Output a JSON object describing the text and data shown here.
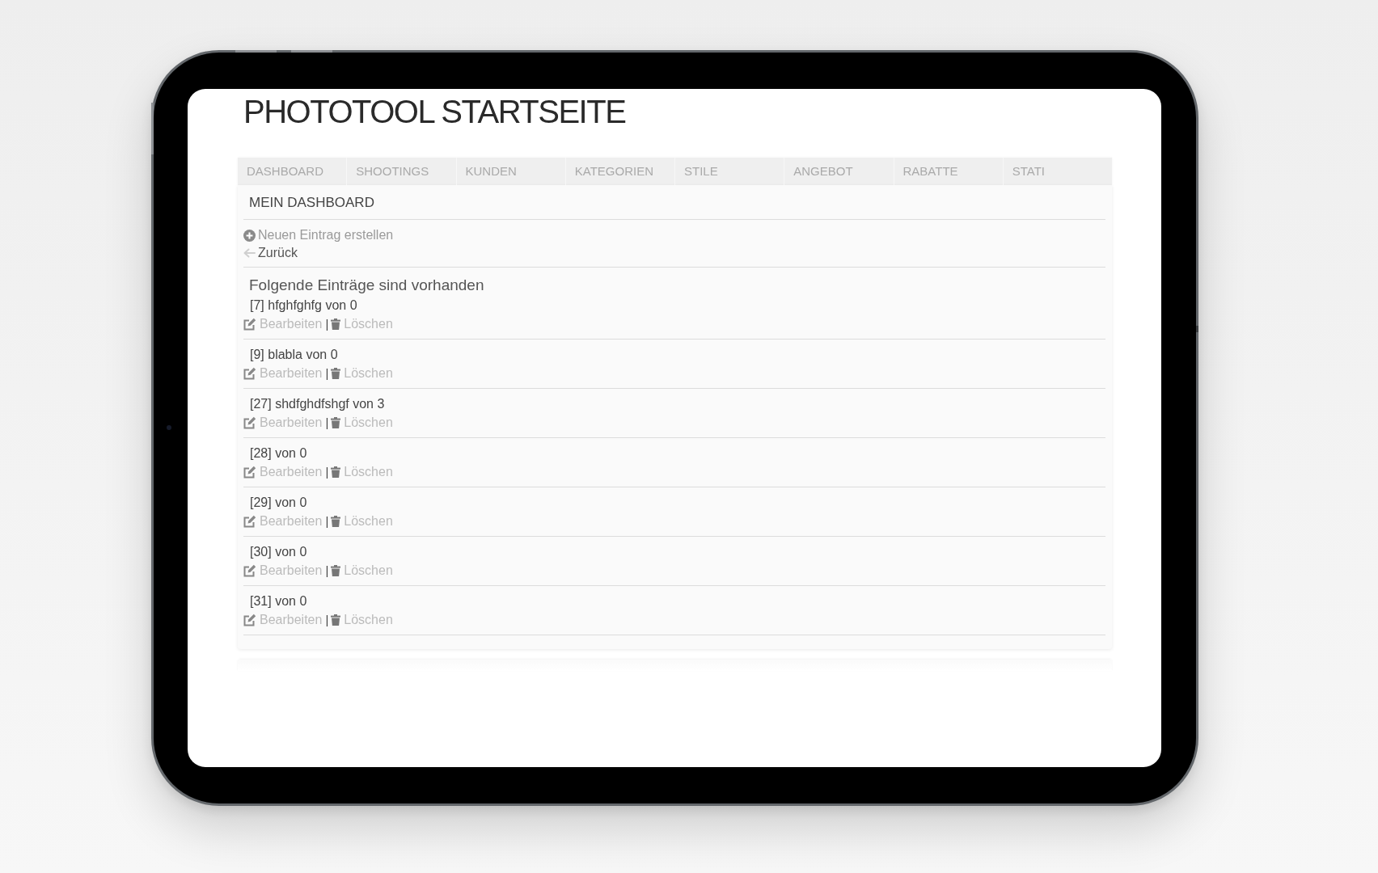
{
  "page_title": "PHOTOTOOL STARTSEITE",
  "nav": [
    {
      "label": "DASHBOARD",
      "selected": false
    },
    {
      "label": "SHOOTINGS",
      "selected": false
    },
    {
      "label": "KUNDEN",
      "selected": false
    },
    {
      "label": "KATEGORIEN",
      "selected": false
    },
    {
      "label": "STILE",
      "selected": false
    },
    {
      "label": "ANGEBOT",
      "selected": false
    },
    {
      "label": "RABATTE",
      "selected": false
    },
    {
      "label": "STATI",
      "selected": false
    }
  ],
  "card": {
    "title": "MEIN DASHBOARD",
    "actions": [
      {
        "kind": "create",
        "label": "Neuen Eintrag erstellen"
      },
      {
        "kind": "back",
        "label": "Zurück"
      }
    ],
    "list_heading": "Folgende Einträge sind vorhanden",
    "entries": [
      {
        "title": "[7] hfghfghfg von 0",
        "edit": "Bearbeiten",
        "separator": "|",
        "delete": "Löschen"
      },
      {
        "title": "[9] blabla von 0",
        "edit": "Bearbeiten",
        "separator": "|",
        "delete": "Löschen"
      },
      {
        "title": "[27] shdfghdfshgf von 3",
        "edit": "Bearbeiten",
        "separator": "|",
        "delete": "Löschen"
      },
      {
        "title": "[28] von 0",
        "edit": "Bearbeiten",
        "separator": "|",
        "delete": "Löschen"
      },
      {
        "title": "[29] von 0",
        "edit": "Bearbeiten",
        "separator": "|",
        "delete": "Löschen"
      },
      {
        "title": "[30] von 0",
        "edit": "Bearbeiten",
        "separator": "|",
        "delete": "Löschen"
      },
      {
        "title": "[31] von 0",
        "edit": "Bearbeiten",
        "separator": "|",
        "delete": "Löschen"
      }
    ]
  }
}
